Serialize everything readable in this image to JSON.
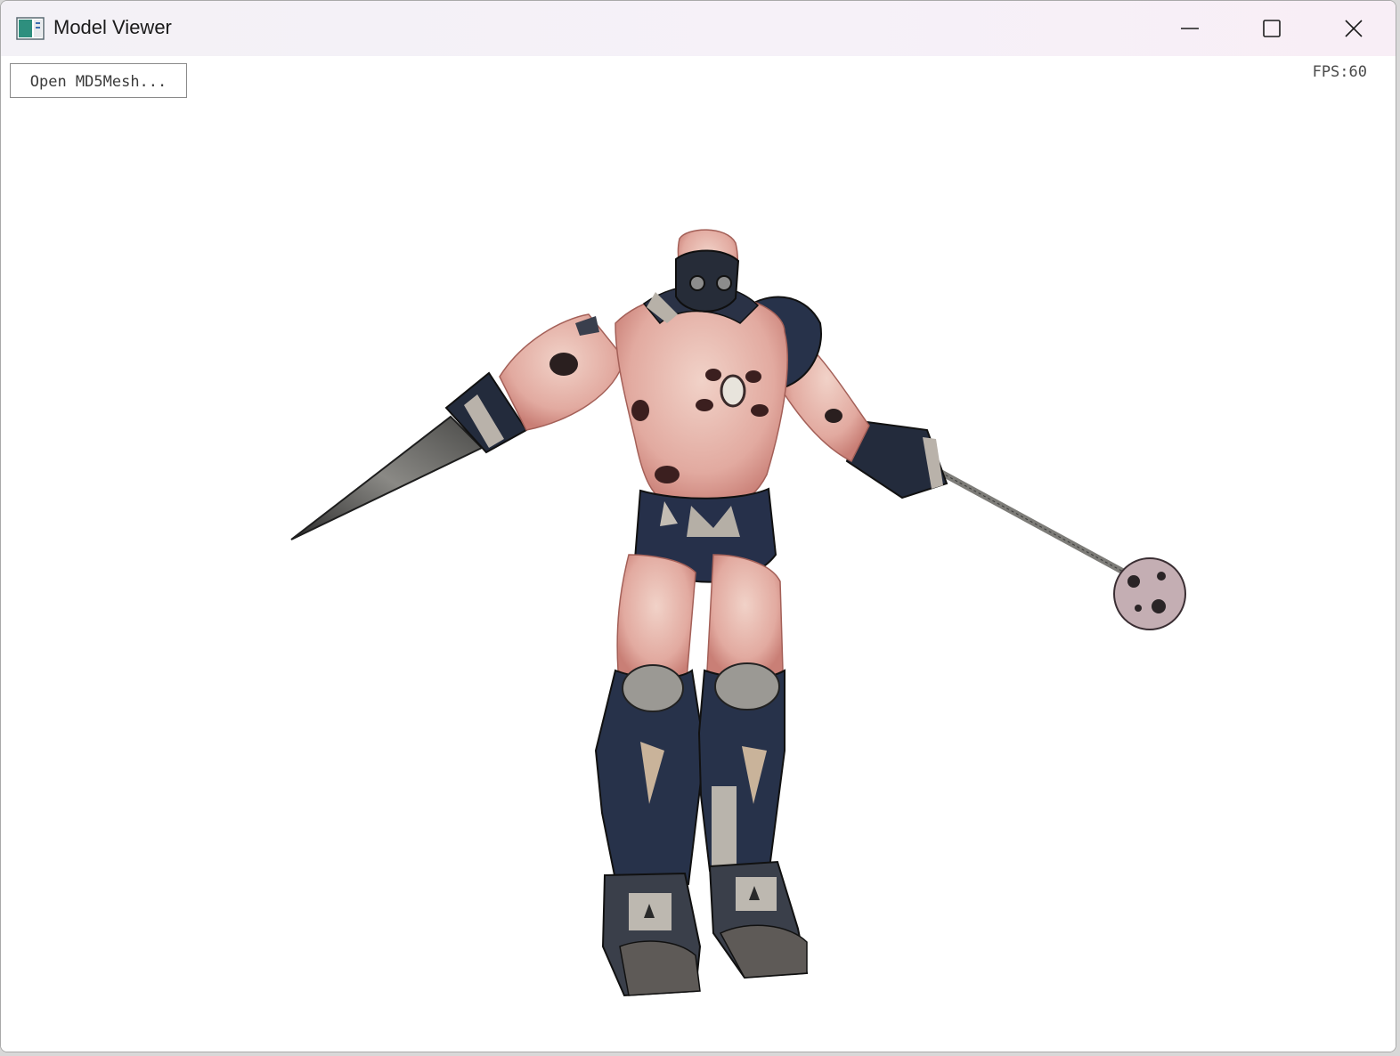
{
  "window": {
    "title": "Model Viewer",
    "icon": "app-window-icon",
    "controls": [
      "minimize-icon",
      "maximize-icon",
      "close-icon"
    ]
  },
  "toolbar": {
    "open_button_label": "Open MD5Mesh..."
  },
  "status": {
    "fps_text": "FPS:60"
  },
  "viewport": {
    "background": "#ffffff",
    "model": "textured-character-model"
  },
  "colors": {
    "titlebar": "#f4f1f7",
    "flesh": "#e8b8b0",
    "armor": "#26324a",
    "metal": "#7d7c78"
  }
}
